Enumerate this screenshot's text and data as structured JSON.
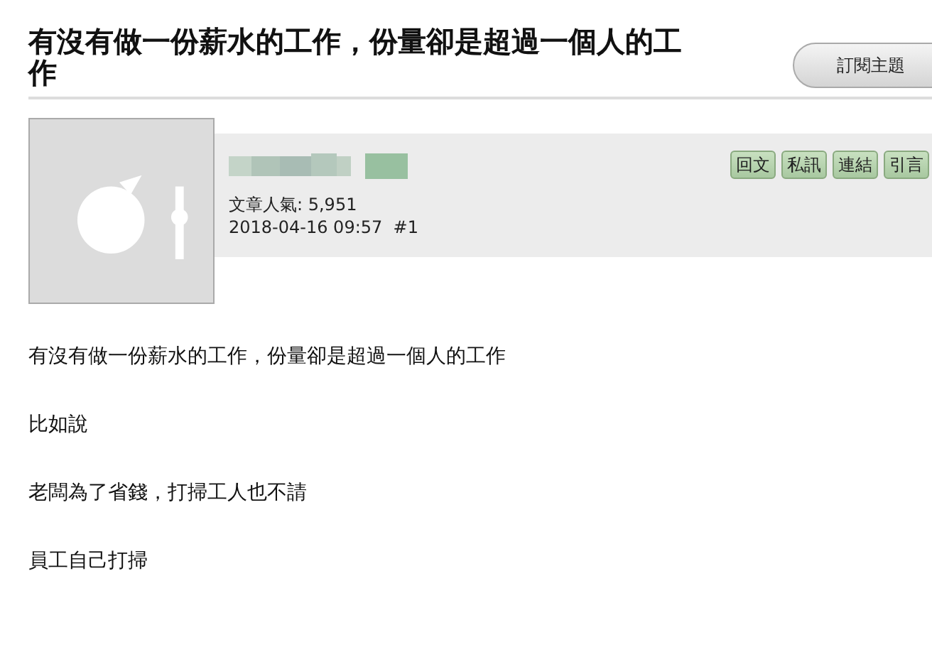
{
  "title": "有沒有做一份薪水的工作，份量卻是超過一個人的工作",
  "subscribe_button": "訂閱主題",
  "post": {
    "actions": [
      "回文",
      "私訊",
      "連結",
      "引言"
    ],
    "popularity": "文章人氣: 5,951",
    "meta": "2018-04-16 09:57  #1",
    "body": [
      "有沒有做一份薪水的工作，份量卻是超過一個人的工作",
      "比如說",
      "老闆為了省錢，打掃工人也不請",
      "員工自己打掃"
    ]
  }
}
